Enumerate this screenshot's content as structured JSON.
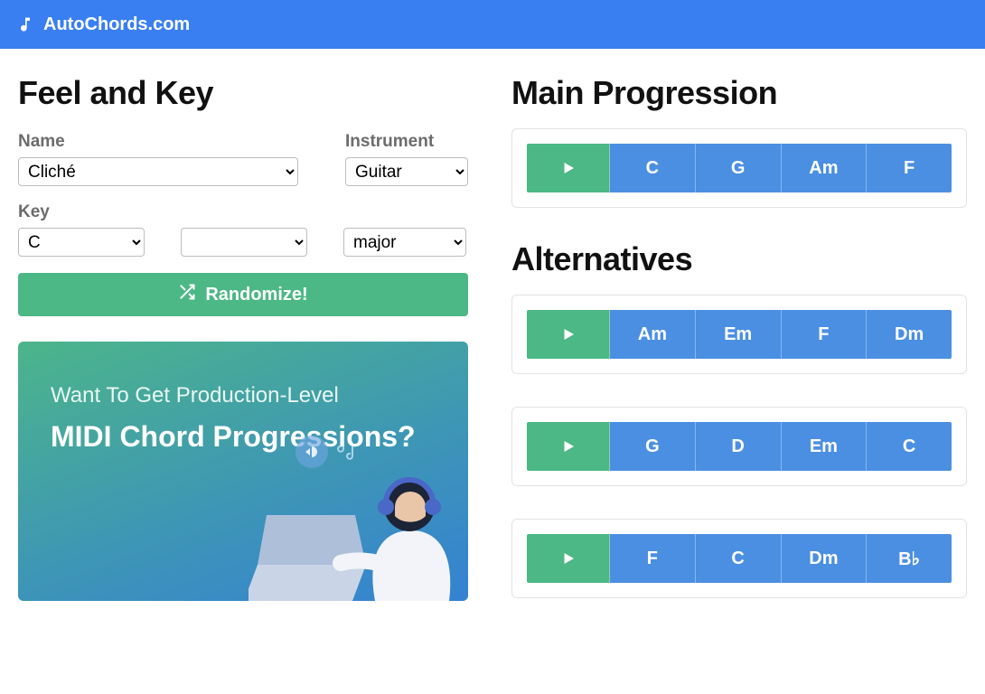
{
  "header": {
    "brand": "AutoChords.com"
  },
  "left": {
    "heading": "Feel and Key",
    "name_label": "Name",
    "name_value": "Cliché",
    "instrument_label": "Instrument",
    "instrument_value": "Guitar",
    "key_label": "Key",
    "key_root": "C",
    "key_accidental": "",
    "key_scale": "major",
    "randomize_label": "Randomize!",
    "promo_line1": "Want To Get Production-Level",
    "promo_line2": "MIDI Chord Progressions?"
  },
  "right": {
    "main_heading": "Main Progression",
    "alt_heading": "Alternatives",
    "main": [
      "C",
      "G",
      "Am",
      "F"
    ],
    "alternatives": [
      [
        "Am",
        "Em",
        "F",
        "Dm"
      ],
      [
        "G",
        "D",
        "Em",
        "C"
      ],
      [
        "F",
        "C",
        "Dm",
        "B♭"
      ]
    ]
  }
}
